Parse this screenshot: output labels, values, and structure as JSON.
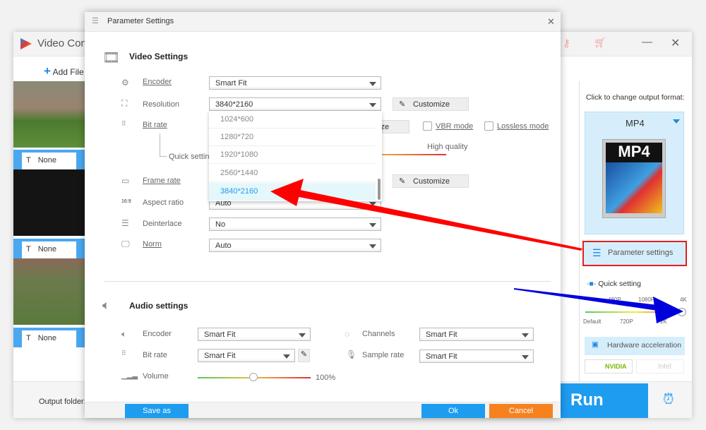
{
  "main_window": {
    "title": "Video Conv",
    "add_files": "Add File",
    "thumbnail_labels": [
      "None",
      "None",
      "None"
    ],
    "output_folder_label": "Output folder:",
    "run": "Run"
  },
  "right_panel": {
    "change_format": "Click to change output format:",
    "format": "MP4",
    "format_icon_text": "MP4",
    "parameter_settings": "Parameter settings",
    "quick_setting": "Quick setting",
    "quality_top": [
      "480P",
      "1080P",
      "4K"
    ],
    "quality_bottom": [
      "Default",
      "720P",
      "2K"
    ],
    "quick_setting_level": "4K",
    "hardware_acceleration": "Hardware acceleration",
    "nvidia": "NVIDIA",
    "intel": "Intel"
  },
  "dialog": {
    "title": "Parameter Settings",
    "video": {
      "heading": "Video Settings",
      "encoder": {
        "label": "Encoder",
        "value": "Smart Fit"
      },
      "resolution": {
        "label": "Resolution",
        "value": "3840*2160",
        "customize": "Customize",
        "options": [
          "1024*600",
          "1280*720",
          "1920*1080",
          "2560*1440",
          "3840*2160"
        ],
        "selected": "3840*2160"
      },
      "bitrate": {
        "label": "Bit rate",
        "customize_partial": "ize",
        "vbr": "VBR mode",
        "lossless": "Lossless mode",
        "quick_setting": "Quick setting",
        "high_quality": "High quality"
      },
      "framerate": {
        "label": "Frame rate",
        "customize": "Customize"
      },
      "aspect": {
        "label": "Aspect ratio",
        "value": "Auto",
        "icon_text": "16:9"
      },
      "deinterlace": {
        "label": "Deinterlace",
        "value": "No"
      },
      "norm": {
        "label": "Norm",
        "value": "Auto"
      }
    },
    "audio": {
      "heading": "Audio settings",
      "encoder": {
        "label": "Encoder",
        "value": "Smart Fit"
      },
      "bitrate": {
        "label": "Bit rate",
        "value": "Smart Fit"
      },
      "volume": {
        "label": "Volume",
        "value": "100%"
      },
      "channels": {
        "label": "Channels",
        "value": "Smart Fit"
      },
      "samplerate": {
        "label": "Sample rate",
        "value": "Smart Fit"
      }
    },
    "save_as": "Save as",
    "ok": "Ok",
    "cancel": "Cancel"
  },
  "colors": {
    "accent": "#1e9cf0",
    "cancel": "#f5821f",
    "highlight_row": "#e4f7fb",
    "arrow_red": "#ff0000",
    "arrow_blue": "#0000dd"
  }
}
